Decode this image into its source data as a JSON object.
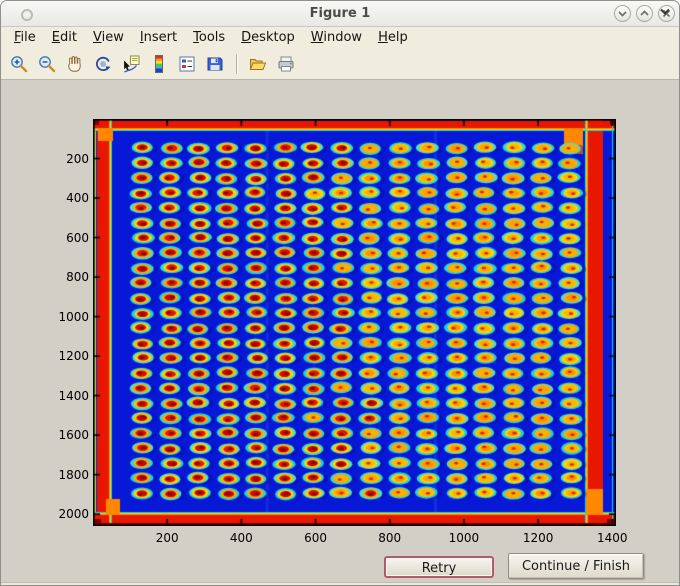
{
  "window": {
    "title": "Figure 1",
    "controls": [
      {
        "name": "shade-button",
        "icon": "chevron-down-icon"
      },
      {
        "name": "maximize-button",
        "icon": "chevron-up-icon"
      },
      {
        "name": "close-button",
        "icon": "close-icon"
      }
    ]
  },
  "menu": {
    "items": [
      "File",
      "Edit",
      "View",
      "Insert",
      "Tools",
      "Desktop",
      "Window",
      "Help"
    ],
    "overflow_icon": "chevron-down-icon"
  },
  "toolbar": {
    "tools": [
      "zoom-in",
      "zoom-out",
      "pan-hand",
      "rotate-3d",
      "data-cursor",
      "insert-colorbar",
      "insert-legend",
      "save-figure",
      "open-file",
      "print-figure"
    ]
  },
  "actions": {
    "retry_label": "Retry",
    "continue_label": "Continue / Finish"
  },
  "chart_data": {
    "type": "heatmap",
    "title": "",
    "xlabel": "",
    "ylabel": "",
    "description": "Pseudocolor (jet colormap) scanned image of a spot microarray / plate: 16 x 24 grid of red-orange spots with cyan halos on a saturated blue background; bright red saturation bands along all four scan edges; y-axis reversed (image display).",
    "colormap": "jet",
    "xlim": [
      0,
      1410
    ],
    "ylim": [
      0,
      2060
    ],
    "y_axis_direction": "reverse",
    "x_ticks": [
      200,
      400,
      600,
      800,
      1000,
      1200,
      1400
    ],
    "y_ticks": [
      200,
      400,
      600,
      800,
      1000,
      1200,
      1400,
      1600,
      1800,
      2000
    ],
    "grid_lines": false,
    "box": true,
    "tick_direction": "in",
    "spot_grid": {
      "cols": 16,
      "rows": 24,
      "x_first": 132,
      "x_step": 77,
      "y_first": 147,
      "y_step": 76
    },
    "colors": {
      "background": "#0719d6",
      "seam": "rgba(70,120,255,0.22)",
      "halo": [
        "#17d3e8",
        "#2bdcd8",
        "#49e2cf"
      ],
      "ring": [
        "#ffd200",
        "#ffc000",
        "#ffaa00"
      ],
      "core_red": [
        "#e01400",
        "#d00c00",
        "#c40400"
      ],
      "core_orange": [
        "#ffa200",
        "#ff9000",
        "#f7b500"
      ],
      "speck_dark": "#8e0000",
      "speck_red": "#d42800",
      "shadow": "rgba(0,10,140,0.35)",
      "edge_band": "#e81800",
      "edge_orange": "#ff8800",
      "edge_yellow": "#ffd000",
      "edge_cyan": "#00dce8",
      "corner_dark": "#7a0000",
      "axis": "#000000"
    }
  }
}
